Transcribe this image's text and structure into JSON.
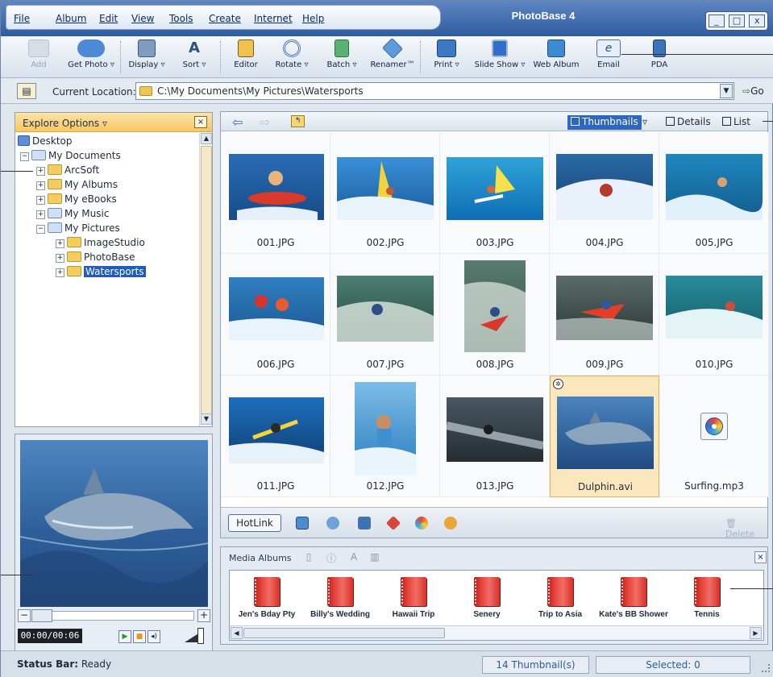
{
  "app": {
    "title": "PhotoBase 4"
  },
  "menu": [
    {
      "label": "File"
    },
    {
      "label": "Album"
    },
    {
      "label": "Edit"
    },
    {
      "label": "View"
    },
    {
      "label": "Tools"
    },
    {
      "label": "Create"
    },
    {
      "label": "Internet"
    },
    {
      "label": "Help"
    }
  ],
  "window_controls": {
    "minimize": "_",
    "maximize": "□",
    "close": "x"
  },
  "toolbar": {
    "add": "Add",
    "get_photo": "Get Photo",
    "display": "Display",
    "sort": "Sort",
    "editor": "Editor",
    "rotate": "Rotate",
    "batch": "Batch",
    "renamer": "Renamer™",
    "print": "Print",
    "slide_show": "Slide Show",
    "web_album": "Web Album",
    "email": "Email",
    "pda": "PDA",
    "dropdown_arrow": "▿"
  },
  "location": {
    "label": "Current Location:",
    "value": "C:\\My Documents\\My Pictures\\Watersports",
    "go": "Go"
  },
  "explore": {
    "title": "Explore Options",
    "close": "×",
    "tree": [
      {
        "label": "Desktop",
        "toggle": ""
      },
      {
        "label": "My Documents",
        "toggle": "−"
      },
      {
        "label": "ArcSoft",
        "toggle": "+"
      },
      {
        "label": "My Albums",
        "toggle": "+"
      },
      {
        "label": "My eBooks",
        "toggle": "+"
      },
      {
        "label": "My Music",
        "toggle": "+"
      },
      {
        "label": "My Pictures",
        "toggle": "−"
      },
      {
        "label": "ImageStudio",
        "toggle": "+"
      },
      {
        "label": "PhotoBase",
        "toggle": "+"
      },
      {
        "label": "Watersports",
        "toggle": "+"
      }
    ],
    "selected": "Watersports"
  },
  "preview": {
    "timecode": "00:00/00:06",
    "minus": "−",
    "plus": "+"
  },
  "thumbnails": {
    "views": {
      "thumbnails": "Thumbnails",
      "details": "Details",
      "list": "List"
    },
    "items": [
      {
        "name": "001.JPG"
      },
      {
        "name": "002.JPG"
      },
      {
        "name": "003.JPG"
      },
      {
        "name": "004.JPG"
      },
      {
        "name": "005.JPG"
      },
      {
        "name": "006.JPG"
      },
      {
        "name": "007.JPG"
      },
      {
        "name": "008.JPG"
      },
      {
        "name": "009.JPG"
      },
      {
        "name": "010.JPG"
      },
      {
        "name": "011.JPG"
      },
      {
        "name": "012.JPG"
      },
      {
        "name": "013.JPG"
      },
      {
        "name": "Dulphin.avi"
      },
      {
        "name": "Surfing.mp3"
      }
    ],
    "selected": "Dulphin.avi"
  },
  "hotbar": {
    "hotlink": "HotLink",
    "delete": "Delete"
  },
  "albums": {
    "title": "Media Albums",
    "close": "×",
    "items": [
      {
        "label": "Jen's Bday Pty"
      },
      {
        "label": "Billy's Wedding"
      },
      {
        "label": "Hawaii Trip"
      },
      {
        "label": "Senery"
      },
      {
        "label": "Trip to Asia"
      },
      {
        "label": "Kate's BB Shower"
      },
      {
        "label": "Tennis"
      }
    ]
  },
  "status": {
    "label": "Status Bar:",
    "value": "Ready",
    "thumb_count": "14 Thumbnail(s)",
    "selected": "Selected: 0"
  },
  "colors": {
    "accent": "#2c67c4",
    "title_bar": "#2f5c9f",
    "panel_head": "#f6c863",
    "album_red": "#e7413a"
  }
}
